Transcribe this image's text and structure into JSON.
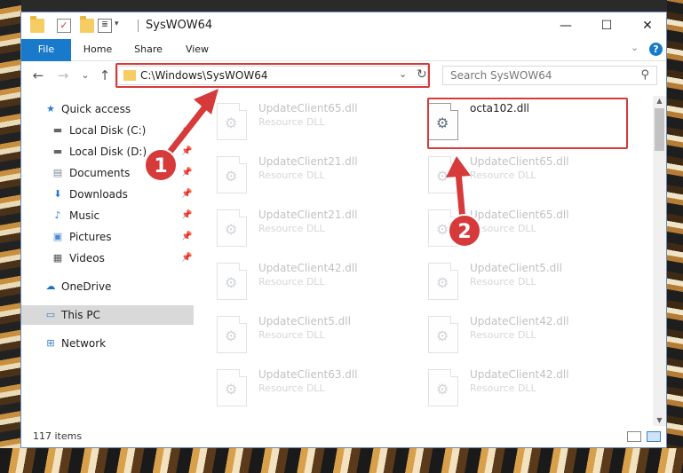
{
  "window": {
    "title": "SysWOW64",
    "minimize": "—",
    "maximize": "☐",
    "close": "✕"
  },
  "ribbon": {
    "tabs": [
      "File",
      "Home",
      "Share",
      "View"
    ],
    "help": "?"
  },
  "nav": {
    "back": "←",
    "forward": "→",
    "recent": "⌄",
    "up": "↑"
  },
  "address": {
    "path": "C:\\Windows\\SysWOW64"
  },
  "search": {
    "placeholder": "Search SysWOW64"
  },
  "sidebar": {
    "items": [
      {
        "label": "Quick access",
        "icon": "star-icon"
      },
      {
        "label": "Local Disk (C:)",
        "icon": "drive-icon"
      },
      {
        "label": "Local Disk (D:)",
        "icon": "drive-icon"
      },
      {
        "label": "Documents",
        "icon": "documents-icon"
      },
      {
        "label": "Downloads",
        "icon": "download-icon"
      },
      {
        "label": "Music",
        "icon": "music-icon"
      },
      {
        "label": "Pictures",
        "icon": "pictures-icon"
      },
      {
        "label": "Videos",
        "icon": "videos-icon"
      },
      {
        "label": "OneDrive",
        "icon": "cloud-icon"
      },
      {
        "label": "This PC",
        "icon": "computer-icon"
      },
      {
        "label": "Network",
        "icon": "network-icon"
      }
    ]
  },
  "files": {
    "highlighted": {
      "name": "octa102.dll",
      "type": ""
    },
    "left": [
      {
        "name": "UpdateClient65.dll",
        "type": "Resource DLL"
      },
      {
        "name": "UpdateClient21.dll",
        "type": "Resource DLL"
      },
      {
        "name": "UpdateClient21.dll",
        "type": "Resource DLL"
      },
      {
        "name": "UpdateClient42.dll",
        "type": "Resource DLL"
      },
      {
        "name": "UpdateClient5.dll",
        "type": "Resource DLL"
      },
      {
        "name": "UpdateClient63.dll",
        "type": "Resource DLL"
      }
    ],
    "right": [
      {
        "name": "UpdateClient65.dll",
        "type": "Resource DLL"
      },
      {
        "name": "UpdateClient65.dll",
        "type": "Resource DLL"
      },
      {
        "name": "UpdateClient5.dll",
        "type": "Resource DLL"
      },
      {
        "name": "UpdateClient42.dll",
        "type": "Resource DLL"
      },
      {
        "name": "UpdateClient42.dll",
        "type": "Resource DLL"
      }
    ]
  },
  "status": {
    "count": "117 items"
  },
  "markers": [
    "1",
    "2"
  ],
  "colors": {
    "accent": "#1979ca",
    "highlight": "#d63a3a"
  }
}
